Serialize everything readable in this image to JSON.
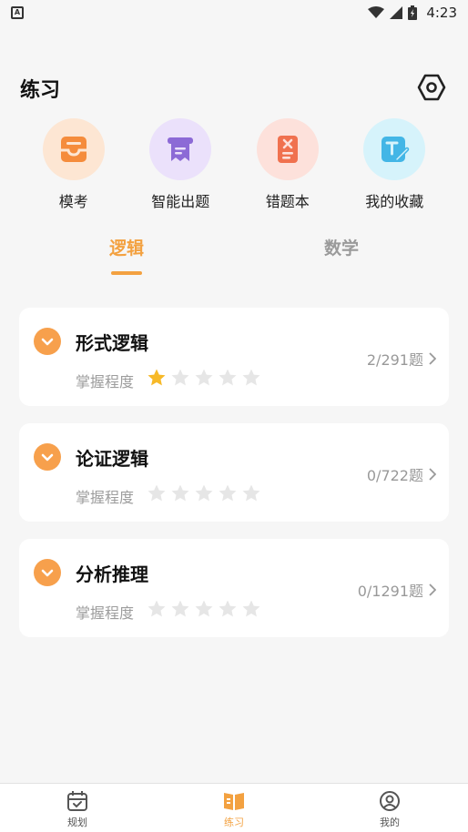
{
  "status_bar": {
    "time": "4:23",
    "icons": [
      "app-notification-icon",
      "wifi-icon",
      "signal-icon",
      "battery-icon"
    ]
  },
  "header": {
    "title": "练习",
    "settings_icon": "settings-hexagon-icon"
  },
  "shortcuts": [
    {
      "label": "模考",
      "icon": "inbox-tray-icon",
      "color": "#f58c3c",
      "bg": "#fde6d3"
    },
    {
      "label": "智能出题",
      "icon": "scroll-icon",
      "color": "#8c6ad6",
      "bg": "#ebe1fb"
    },
    {
      "label": "错题本",
      "icon": "error-notebook-icon",
      "color": "#f0714f",
      "bg": "#fde1db"
    },
    {
      "label": "我的收藏",
      "icon": "edit-text-icon",
      "color": "#43b6e6",
      "bg": "#d6f3fb"
    }
  ],
  "tabs": [
    {
      "label": "逻辑",
      "active": true
    },
    {
      "label": "数学",
      "active": false
    }
  ],
  "categories": [
    {
      "title": "形式逻辑",
      "mastery_label": "掌握程度",
      "rating": 1,
      "max_rating": 5,
      "progress": "2/291题"
    },
    {
      "title": "论证逻辑",
      "mastery_label": "掌握程度",
      "rating": 0,
      "max_rating": 5,
      "progress": "0/722题"
    },
    {
      "title": "分析推理",
      "mastery_label": "掌握程度",
      "rating": 0,
      "max_rating": 5,
      "progress": "0/1291题"
    }
  ],
  "bottom_nav": [
    {
      "label": "规划",
      "icon": "calendar-icon",
      "active": false
    },
    {
      "label": "练习",
      "icon": "open-book-icon",
      "active": true
    },
    {
      "label": "我的",
      "icon": "profile-icon",
      "active": false
    }
  ],
  "colors": {
    "accent": "#f3a140",
    "star_filled": "#f7b928",
    "star_empty": "#e6e6e6"
  }
}
